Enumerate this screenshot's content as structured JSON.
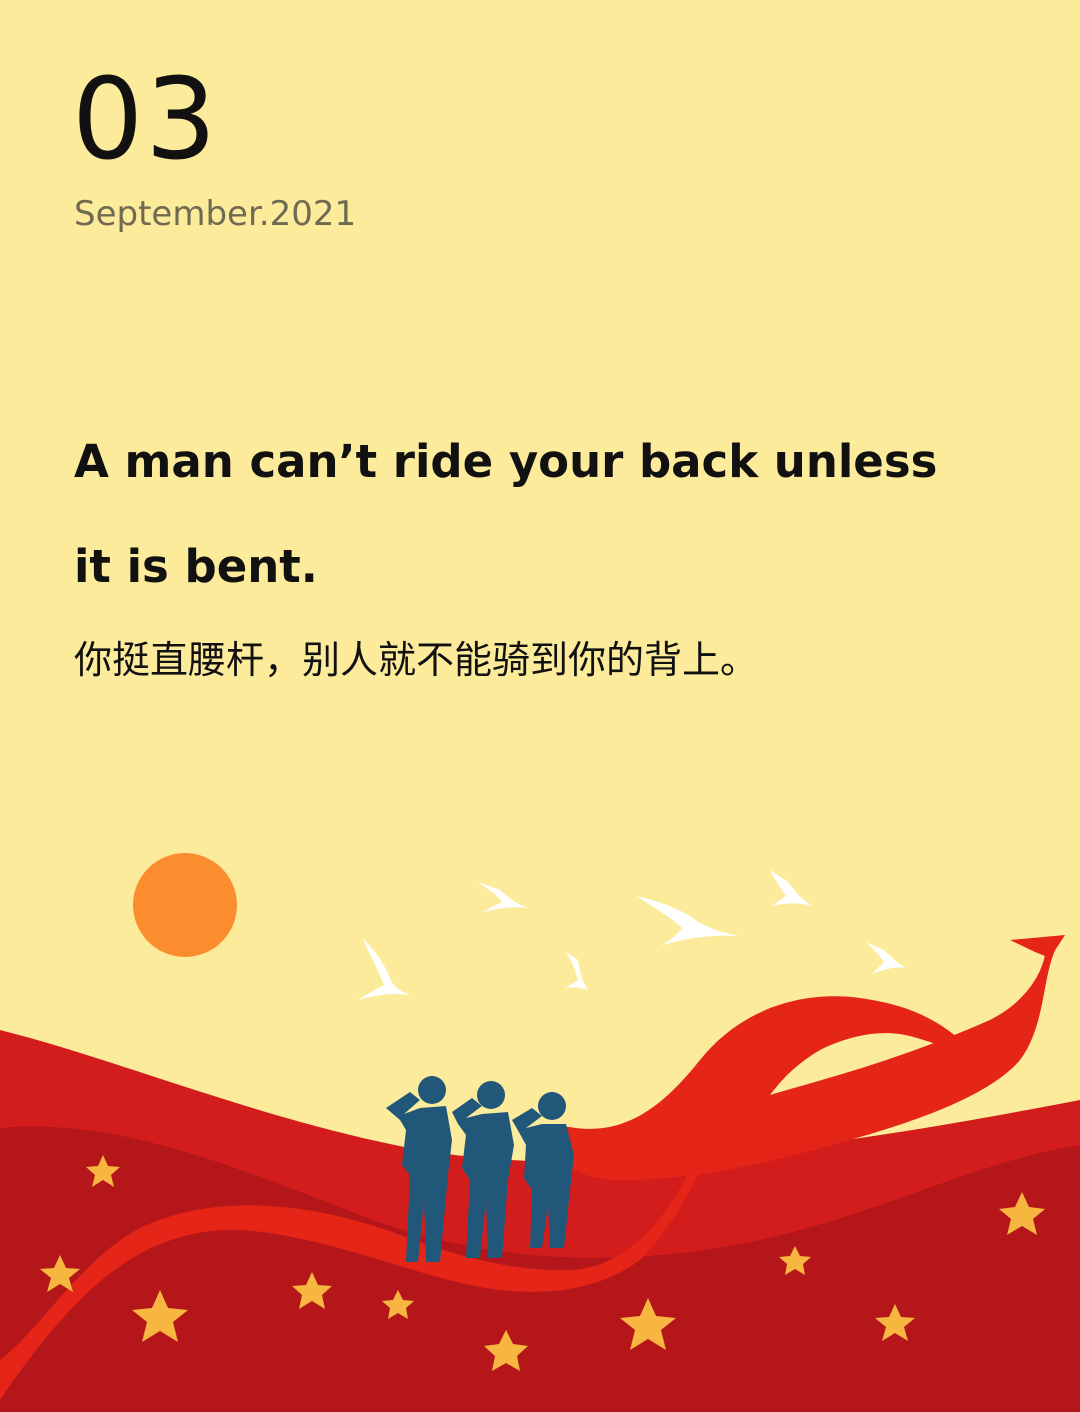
{
  "date": {
    "day": "03",
    "month_year": "September.2021"
  },
  "quote": {
    "english_line1": "A man can’t ride your back unless",
    "english_line2": "it is bent.",
    "chinese": "你挺直腰杆，别人就不能骑到你的背上。"
  },
  "colors": {
    "background": "#fdeb9c",
    "sun": "#fb8d2f",
    "ribbon": "#e42518",
    "hill_dark": "#b5161a",
    "hill_mid": "#d31d1d",
    "soldiers": "#21587a",
    "stars": "#f6b63f",
    "birds": "#ffffff"
  },
  "illustration": {
    "sun_icon": "sun-icon",
    "bird_icon": "dove-icon",
    "star_icon": "star-icon",
    "figure_icon": "saluting-soldier-icon",
    "ribbon_icon": "red-ribbon-icon"
  }
}
